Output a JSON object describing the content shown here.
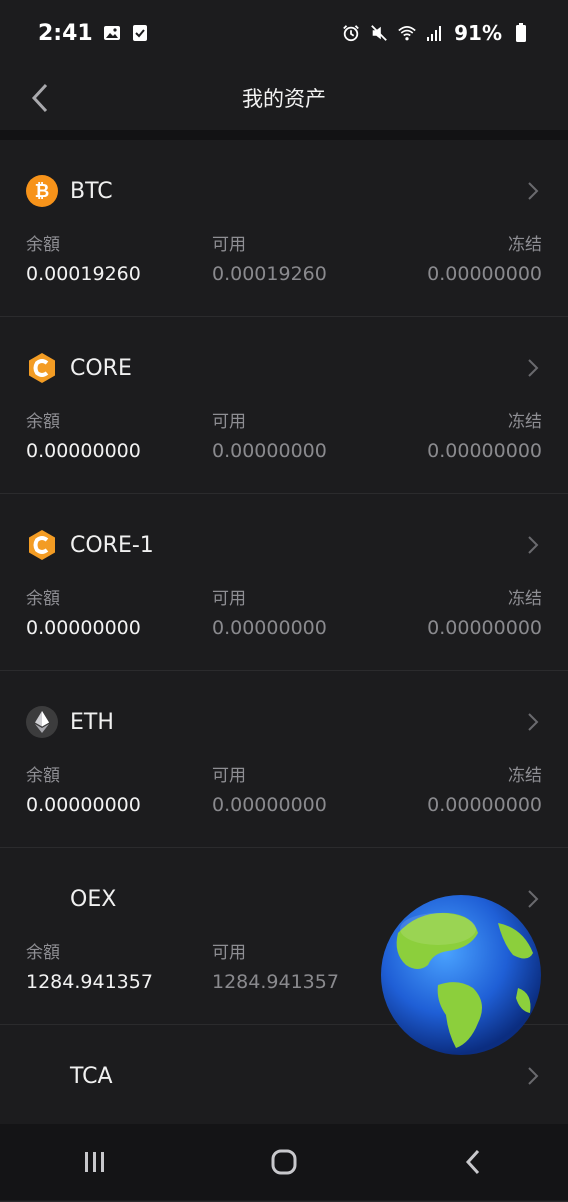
{
  "status": {
    "time": "2:41",
    "battery": "91%",
    "icons": [
      "image-icon",
      "checkbox-icon",
      "alarm-icon",
      "mute-icon",
      "wifi-icon",
      "signal-icon",
      "battery-icon"
    ]
  },
  "header": {
    "title": "我的资产"
  },
  "columns": {
    "balance": "余額",
    "available": "可用",
    "frozen": "冻结"
  },
  "assets": [
    {
      "symbol": "BTC",
      "icon": "bitcoin-icon",
      "color": "#f7931a",
      "balance": "0.00019260",
      "available": "0.00019260",
      "frozen": "0.00000000"
    },
    {
      "symbol": "CORE",
      "icon": "core-icon",
      "color": "#f39c24",
      "balance": "0.00000000",
      "available": "0.00000000",
      "frozen": "0.00000000"
    },
    {
      "symbol": "CORE-1",
      "icon": "core-icon",
      "color": "#f39c24",
      "balance": "0.00000000",
      "available": "0.00000000",
      "frozen": "0.00000000"
    },
    {
      "symbol": "ETH",
      "icon": "ethereum-icon",
      "color": "#3c3c3d",
      "balance": "0.00000000",
      "available": "0.00000000",
      "frozen": "0.00000000"
    },
    {
      "symbol": "OEX",
      "icon": "",
      "color": "",
      "balance": "1284.941357",
      "available": "1284.941357",
      "frozen": ""
    },
    {
      "symbol": "TCA",
      "icon": "",
      "color": "",
      "balance": "",
      "available": "",
      "frozen": ""
    }
  ],
  "nav": [
    "recent-apps-icon",
    "home-icon",
    "back-icon"
  ]
}
